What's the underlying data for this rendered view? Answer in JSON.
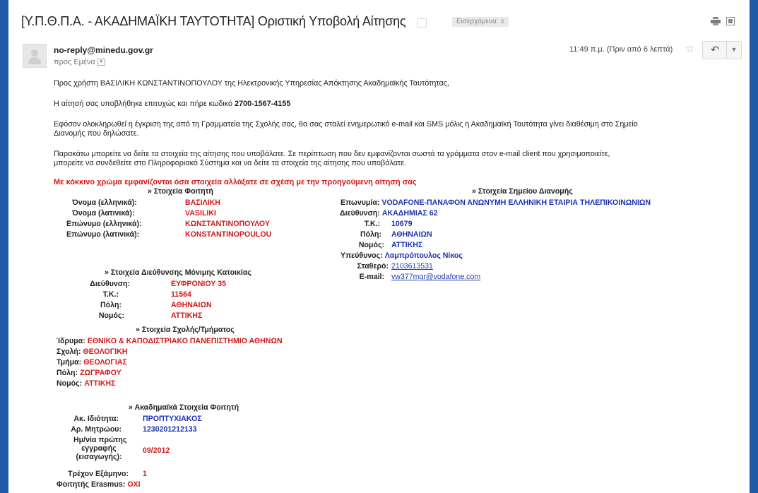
{
  "header": {
    "subject": "[Υ.Π.Θ.Π.Α. - ΑΚΑΔΗΜΑΪΚΗ ΤΑΥΤΟΤΗΤΑ] Οριστική Υποβολή Αίτησης",
    "label_chip": "Εισερχόμενα",
    "label_chip_close": "x"
  },
  "message": {
    "from": "no-reply@minedu.gov.gr",
    "to": "προς Εμένα",
    "time": "11:49 π.μ. (Πριν από 6 λεπτά)",
    "greeting": "Προς χρήστη ΒΑΣΙΛΙΚΗ ΚΩΝΣΤΑΝΤΙΝΟΠΟΥΛΟΥ της Ηλεκτρονικής Υπηρεσίας Απόκτησης Ακαδημαϊκής Ταυτότητας,",
    "submitted_prefix": "Η αίτησή σας υποβλήθηκε επιτυχώς και πήρε κωδικό ",
    "code": "2700-1567-4155",
    "para1_line1": "Εφόσον ολοκληρωθεί η έγκριση της από τη Γραμματεία της Σχολής σας, θα σας σταλεί ενημερωτικό e-mail και SMS μόλις η Ακαδημαϊκή Ταυτότητα γίνει διαθέσιμη στο Σημείο",
    "para1_line2": "Διανομής που δηλώσατε.",
    "para2_line1": "Παρακάτω μπορείτε να δείτε τα στοιχεία της αίτησης που υποβάλατε. Σε περίπτωση που δεν εμφανίζονται σωστά τα γράμματα στον e-mail client που χρησιμοποιείτε,",
    "para2_line2": "μπορείτε να συνδεθείτε στο Πληροφοριακό Σύστημα και να δείτε τα στοιχεία της αίτησης που υποβάλατε.",
    "red_notice": "Με κόκκινο χρώμα εμφανίζονται όσα στοιχεία αλλάξατε σε σχέση με την προηγούμενη αίτησή σας"
  },
  "student": {
    "title": "» Στοιχεία Φοιτητή",
    "rows": [
      {
        "label": "Όνομα (ελληνικά):",
        "value": "ΒΑΣΙΛΙΚΗ"
      },
      {
        "label": "Όνομα (λατινικά):",
        "value": "VASILIKI"
      },
      {
        "label": "Επώνυμο (ελληνικά):",
        "value": "ΚΩΝΣΤΑΝΤΙΝΟΠΟΥΛΟΥ"
      },
      {
        "label": "Επώνυμο (λατινικά):",
        "value": "KONSTANTINOPOULOU"
      }
    ]
  },
  "residence": {
    "title": "» Στοιχεία Διεύθυνσης Μόνιμης Κατοικίας",
    "rows": [
      {
        "label": "Διεύθυνση:",
        "value": "ΕΥΦΡΟΝΙΟΥ 35"
      },
      {
        "label": "Τ.Κ.:",
        "value": "11564"
      },
      {
        "label": "Πόλη:",
        "value": "ΑΘΗΝΑΙΩΝ"
      },
      {
        "label": "Νομός:",
        "value": "ΑΤΤΙΚΗΣ"
      }
    ]
  },
  "school": {
    "title": "» Στοιχεία Σχολής/Τμήματος",
    "rows": [
      {
        "label": "Ίδρυμα:",
        "value": "ΕΘΝΙΚΟ & ΚΑΠΟΔΙΣΤΡΙΑΚΟ ΠΑΝΕΠΙΣΤΗΜΙΟ ΑΘΗΝΩΝ"
      },
      {
        "label": "Σχολή:",
        "value": "ΘΕΟΛΟΓΙΚΗ"
      },
      {
        "label": "Τμήμα:",
        "value": "ΘΕΟΛΟΓΙΑΣ"
      },
      {
        "label": "Πόλη:",
        "value": "ΖΩΓΡΑΦΟΥ"
      },
      {
        "label": "Νομός:",
        "value": "ΑΤΤΙΚΗΣ"
      }
    ]
  },
  "academic": {
    "title": "» Ακαδημαϊκά Στοιχεία Φοιτητή",
    "status_label": "Ακ. Ιδιότητα:",
    "status_value": "ΠΡΟΠΤΥΧΙΑΚΟΣ",
    "reg_label": "Αρ. Μητρώου:",
    "reg_value": "1230201212133",
    "first_reg_l1": "Ημ/νία πρώτης",
    "first_reg_l2": "εγγραφής",
    "first_reg_l3": "(εισαγωγής):",
    "first_reg_value": "09/2012",
    "semester_label": "Τρέχον Εξάμηνο:",
    "semester_value": "1",
    "erasmus_label": "Φοιτητής Erasmus:",
    "erasmus_value": "ΟΧΙ"
  },
  "distribution": {
    "title": "» Στοιχεία Σημείου Διανομής",
    "company_label": "Επωνυμία:",
    "company_value": "VODAFONE-ΠΑΝΑΦΟΝ ΑΝΩΝΥΜΗ ΕΛΛΗΝΙΚΗ ΕΤΑΙΡΙΑ ΤΗΛΕΠΙΚΟΙΝΩΝΙΩΝ",
    "address_label": "Διεύθυνση:",
    "address_value": "ΑΚΑΔΗΜΙΑΣ 62",
    "zip_label": "Τ.Κ.:",
    "zip_value": "10679",
    "city_label": "Πόλη:",
    "city_value": "ΑΘΗΝΑΙΩΝ",
    "county_label": "Νομός:",
    "county_value": "ΑΤΤΙΚΗΣ",
    "manager_label": "Υπεύθυνος:",
    "manager_value": "Λαμπρόπουλος Νίκος",
    "phone_label": "Σταθερό:",
    "phone_value": "2103613531",
    "email_label": "E-mail:",
    "email_value": "vw377mgr@vodafone.com"
  }
}
